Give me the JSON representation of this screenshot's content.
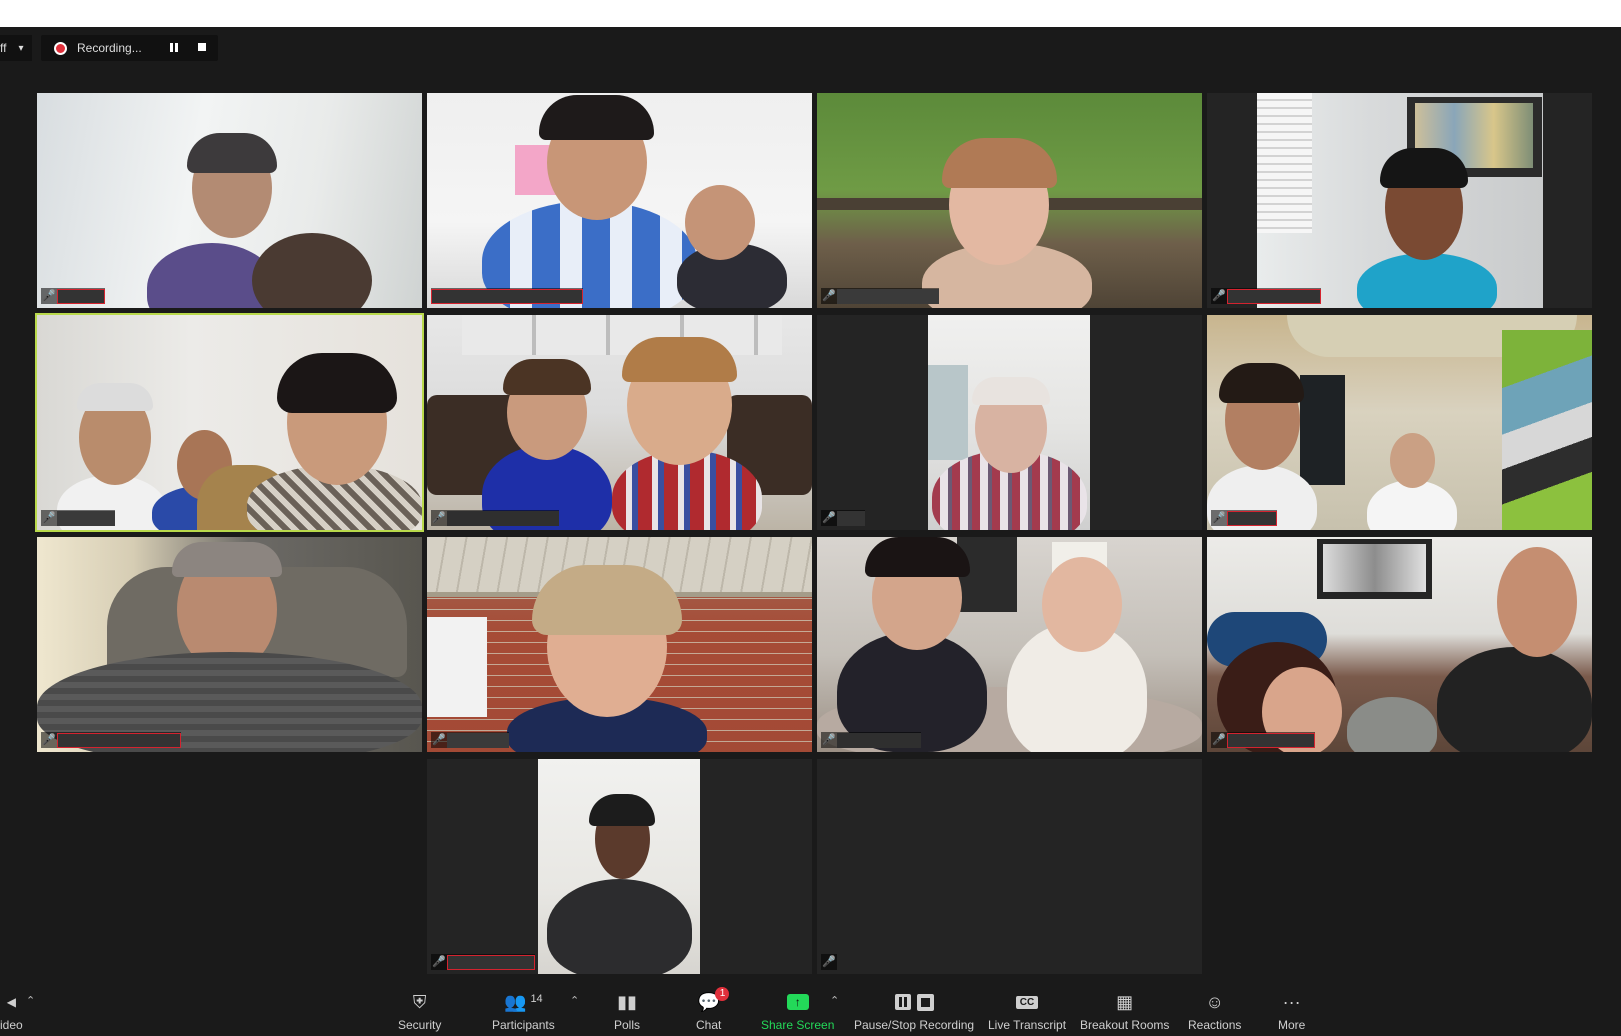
{
  "top_left": {
    "fragment": "ff",
    "caret": "▾"
  },
  "recording": {
    "label": "Recording...",
    "pause_icon": "pause-icon",
    "stop_icon": "stop-icon"
  },
  "toolbar": {
    "video_label": "ideo",
    "security": "Security",
    "participants": "Participants",
    "participants_count": "14",
    "polls": "Polls",
    "chat": "Chat",
    "chat_badge": "1",
    "share_screen": "Share Screen",
    "pause_stop_recording": "Pause/Stop Recording",
    "live_transcript": "Live Transcript",
    "live_transcript_icon_text": "CC",
    "breakout_rooms": "Breakout Rooms",
    "reactions": "Reactions",
    "more": "More"
  },
  "colors": {
    "accent_green": "#23d959",
    "muted_red": "#e8383b",
    "active_speaker": "#b9d94b",
    "background": "#1a1a1a"
  }
}
